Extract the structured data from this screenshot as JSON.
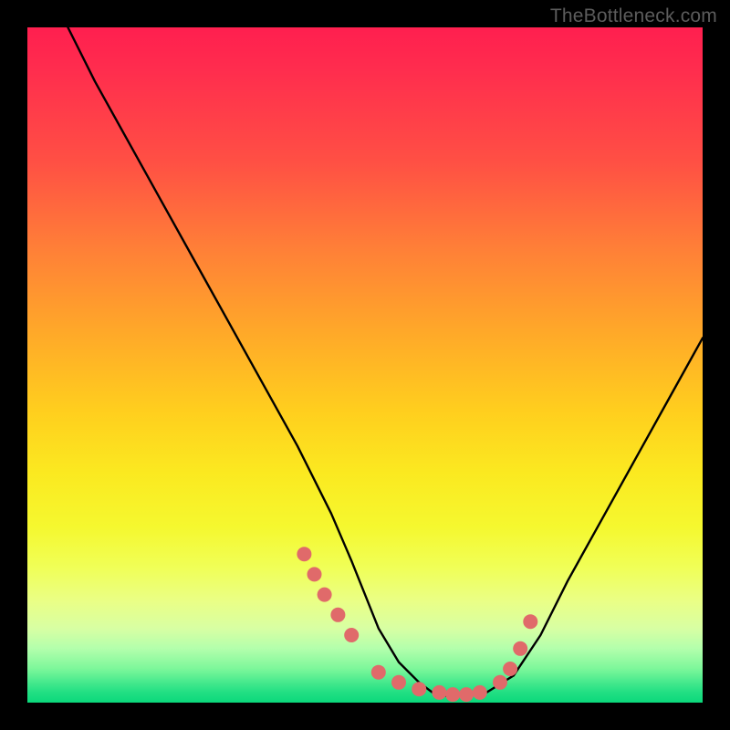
{
  "watermark": "TheBottleneck.com",
  "chart_data": {
    "type": "line",
    "title": "",
    "xlabel": "",
    "ylabel": "",
    "x_range": [
      0,
      100
    ],
    "y_range": [
      0,
      100
    ],
    "curve": {
      "name": "bottleneck-curve",
      "x": [
        6,
        10,
        15,
        20,
        25,
        30,
        35,
        40,
        45,
        48,
        50,
        52,
        55,
        58,
        60,
        62,
        65,
        68,
        72,
        76,
        80,
        85,
        90,
        95,
        100
      ],
      "y": [
        100,
        92,
        83,
        74,
        65,
        56,
        47,
        38,
        28,
        21,
        16,
        11,
        6,
        3,
        1.5,
        1,
        1,
        1.5,
        4,
        10,
        18,
        27,
        36,
        45,
        54
      ]
    },
    "highlight_dots": {
      "name": "sweet-spot-dots",
      "color": "#e06a6a",
      "radius_px": 8,
      "x": [
        41,
        42.5,
        44,
        46,
        48,
        52,
        55,
        58,
        61,
        63,
        65,
        67,
        70,
        71.5,
        73,
        74.5
      ],
      "y": [
        22,
        19,
        16,
        13,
        10,
        4.5,
        3,
        2,
        1.5,
        1.2,
        1.2,
        1.5,
        3,
        5,
        8,
        12
      ]
    },
    "gradient_meaning": "vertical red→yellow→green badness-to-goodness scale"
  }
}
